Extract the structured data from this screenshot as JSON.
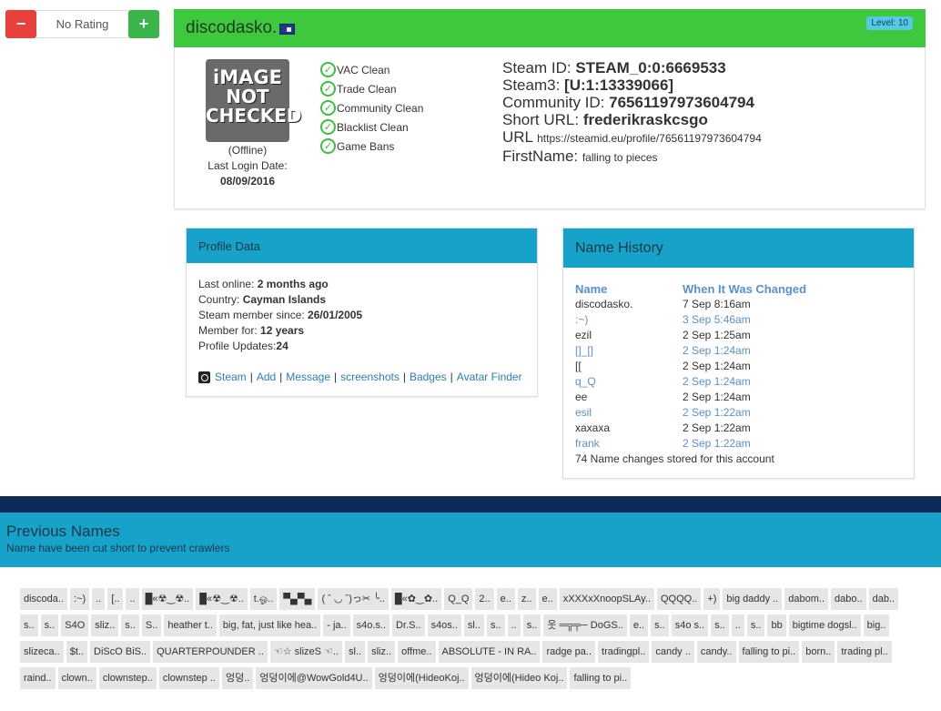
{
  "rating": {
    "minus": "−",
    "value": "No Rating",
    "plus": "+"
  },
  "profile": {
    "name": "discodasko.",
    "level": "Level: 10",
    "avatar_text": [
      "iMAGE",
      "NOT",
      "CHECKED"
    ],
    "status": "(Offline)",
    "last_login_label": "Last Login Date:",
    "last_login": "08/09/2016",
    "checks": [
      "VAC Clean",
      "Trade Clean",
      "Community Clean",
      "Blacklist Clean",
      "Game Bans"
    ],
    "ids": {
      "steamid_label": "Steam ID: ",
      "steamid": "STEAM_0:0:6669533",
      "steam3_label": "Steam3: ",
      "steam3": "[U:1:13339066]",
      "community_label": "Community ID: ",
      "community": "76561197973604794",
      "short_label": "Short URL: ",
      "short": "frederikraskcsgo",
      "url_label": "URL ",
      "url": "https://steamid.eu/profile/76561197973604794",
      "firstname_label": "FirstName: ",
      "firstname": "falling to pieces"
    }
  },
  "profile_data": {
    "title": "Profile Data",
    "last_online_label": "Last online: ",
    "last_online": "2 months ago",
    "country_label": "Country: ",
    "country": "Cayman Islands",
    "member_since_label": "Steam member since: ",
    "member_since": "26/01/2005",
    "member_for_label": "Member for: ",
    "member_for": "12 years",
    "updates_label": "Profile Updates:",
    "updates": "24",
    "links": [
      "Steam",
      "Add",
      "Message",
      "screenshots",
      "Badges",
      "Avatar Finder"
    ]
  },
  "name_history": {
    "title": "Name History",
    "col_name": "Name",
    "col_changed": "When It Was Changed",
    "rows": [
      [
        "discodasko.",
        "7 Sep 8:16am"
      ],
      [
        ":~)",
        "3 Sep 5:46am"
      ],
      [
        "ezil",
        "2 Sep 1:25am"
      ],
      [
        "[]_[]",
        "2 Sep 1:24am"
      ],
      [
        "[[",
        "2 Sep 1:24am"
      ],
      [
        "q_Q",
        "2 Sep 1:24am"
      ],
      [
        "ee",
        "2 Sep 1:24am"
      ],
      [
        "esil",
        "2 Sep 1:22am"
      ],
      [
        "xaxaxa",
        "2 Sep 1:22am"
      ],
      [
        "frank",
        "2 Sep 1:22am"
      ]
    ],
    "footer": "74 Name changes stored for this account"
  },
  "previous": {
    "title": "Previous Names",
    "subtitle": "Name have been cut short to prevent crawlers",
    "names": [
      "discoda..",
      ":~)",
      "..",
      "[..",
      "..",
      "█«☢‿☢..",
      "█«☢‿☢..",
      "t.ஓ..",
      "▀▄▀▄",
      "( ˆ ◡ ˆ)っ✂ ╰..",
      "█«✿‿✿..",
      "Q_Q",
      "2..",
      "e..",
      "z..",
      "e..",
      "xXXXxXnoopSLAy..",
      "QQQQ..",
      "+)",
      "big daddy ..",
      "dabom..",
      "dabo..",
      "dab..",
      "s..",
      "s..",
      "S4O",
      "sliz..",
      "s..",
      "S..",
      "heather t..",
      "big, fat, just like hea..",
      "- ja..",
      "s4o.s..",
      "Dr.S..",
      "s4os..",
      "sl..",
      "s..",
      "..",
      "s..",
      "웃 ═╦╤─ DoGS..",
      "e..",
      "s..",
      "s4o s..",
      "s..",
      "..",
      "s..",
      "bb",
      "bigtime dogsl..",
      "big..",
      "slizeca..",
      "$t..",
      "DiScO BiS..",
      "QUARTERPOUNDER ..",
      "☜☆ slizeS ☜..",
      "sl..",
      "sliz..",
      "offme..",
      "ABSOLUTE - IN RA..",
      "radge pa..",
      "tradingpl..",
      "candy ..",
      "candy..",
      "falling to pi..",
      "born..",
      "trading pl..",
      "raind..",
      "clown..",
      "clownstep..",
      "clownstep ..",
      "엉덩..",
      "엉덩이에@WowGold4U..",
      "엉덩이에(HideoKoj..",
      "엉덩이에(Hideo Koj..",
      "falling to pi.."
    ]
  }
}
